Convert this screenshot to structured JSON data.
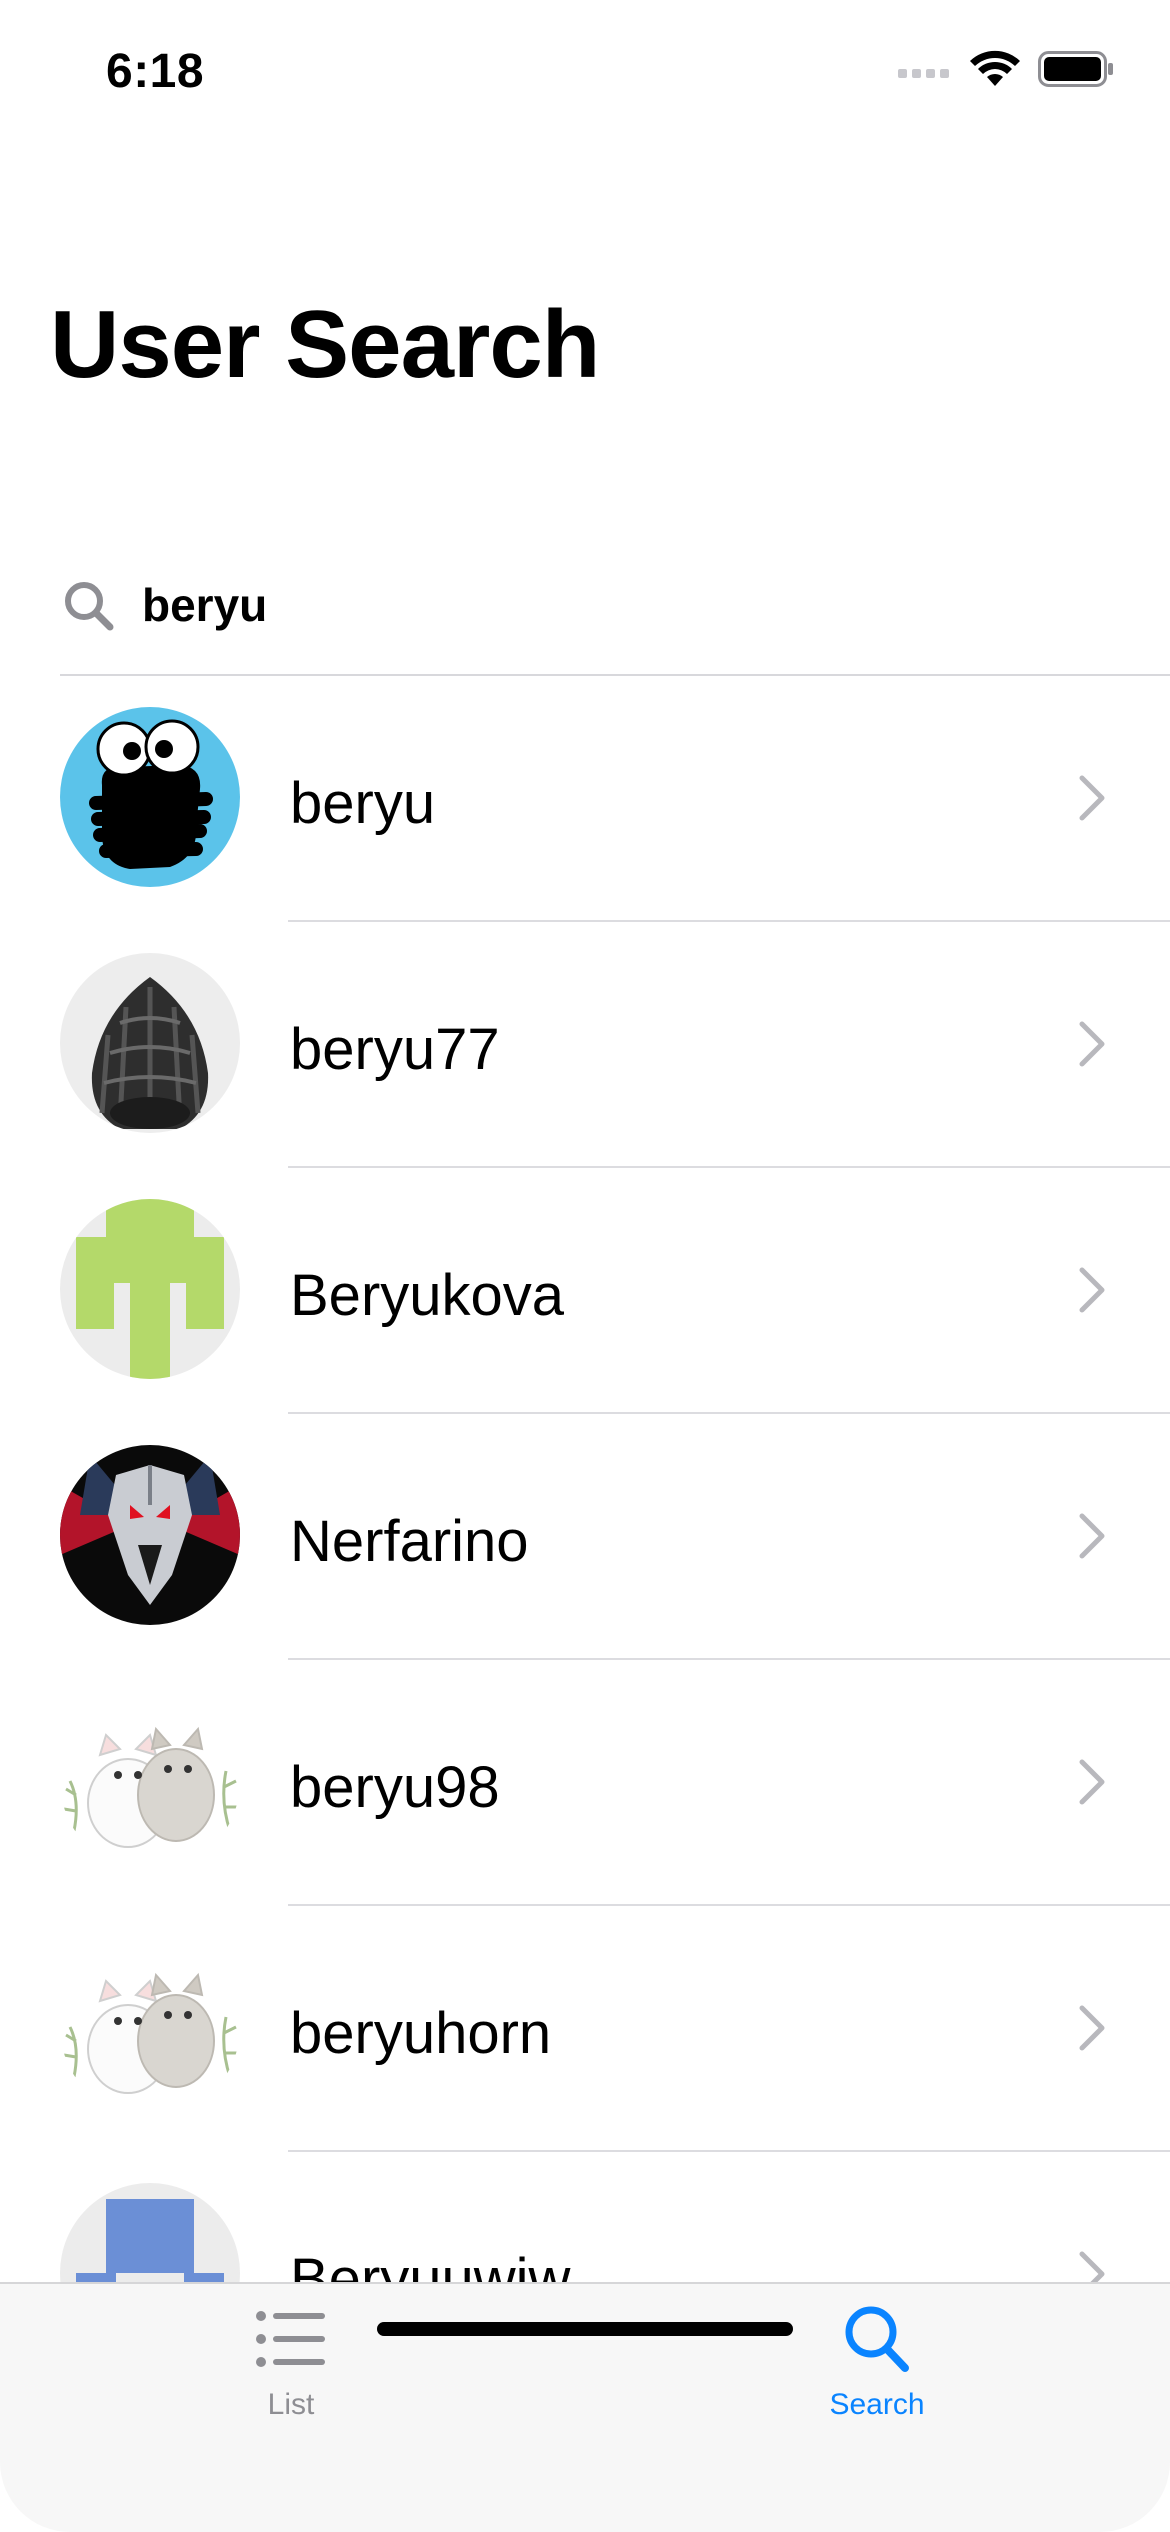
{
  "status_bar": {
    "time": "6:18",
    "signal_icon": "cellular-signal-icon",
    "wifi_icon": "wifi-icon",
    "battery_icon": "battery-icon"
  },
  "header": {
    "title": "User Search"
  },
  "search": {
    "icon": "search-icon",
    "value": "beryu"
  },
  "users": [
    {
      "name": "beryu",
      "avatar": "cookie-monster-avatar",
      "accent": "#5bc3ea"
    },
    {
      "name": "beryu77",
      "avatar": "naga-statue-avatar",
      "accent": "#3a3a3a"
    },
    {
      "name": "Beryukova",
      "avatar": "identicon-green-avatar",
      "accent": "#b4d96a"
    },
    {
      "name": "Nerfarino",
      "avatar": "witcher-wolf-avatar",
      "accent": "#c81e28"
    },
    {
      "name": "beryu98",
      "avatar": "cats-avatar",
      "accent": "#e8e4dc"
    },
    {
      "name": "beryuhorn",
      "avatar": "cats-avatar",
      "accent": "#e8e4dc"
    },
    {
      "name": "Beryuuwiw",
      "avatar": "identicon-blue-avatar",
      "accent": "#6b8fd6"
    }
  ],
  "tab_bar": {
    "tabs": [
      {
        "label": "List",
        "icon": "list-icon",
        "selected": false
      },
      {
        "label": "Search",
        "icon": "search-icon",
        "selected": true
      }
    ]
  },
  "colors": {
    "accent": "#0a84ff",
    "inactive": "#8e8e93"
  }
}
